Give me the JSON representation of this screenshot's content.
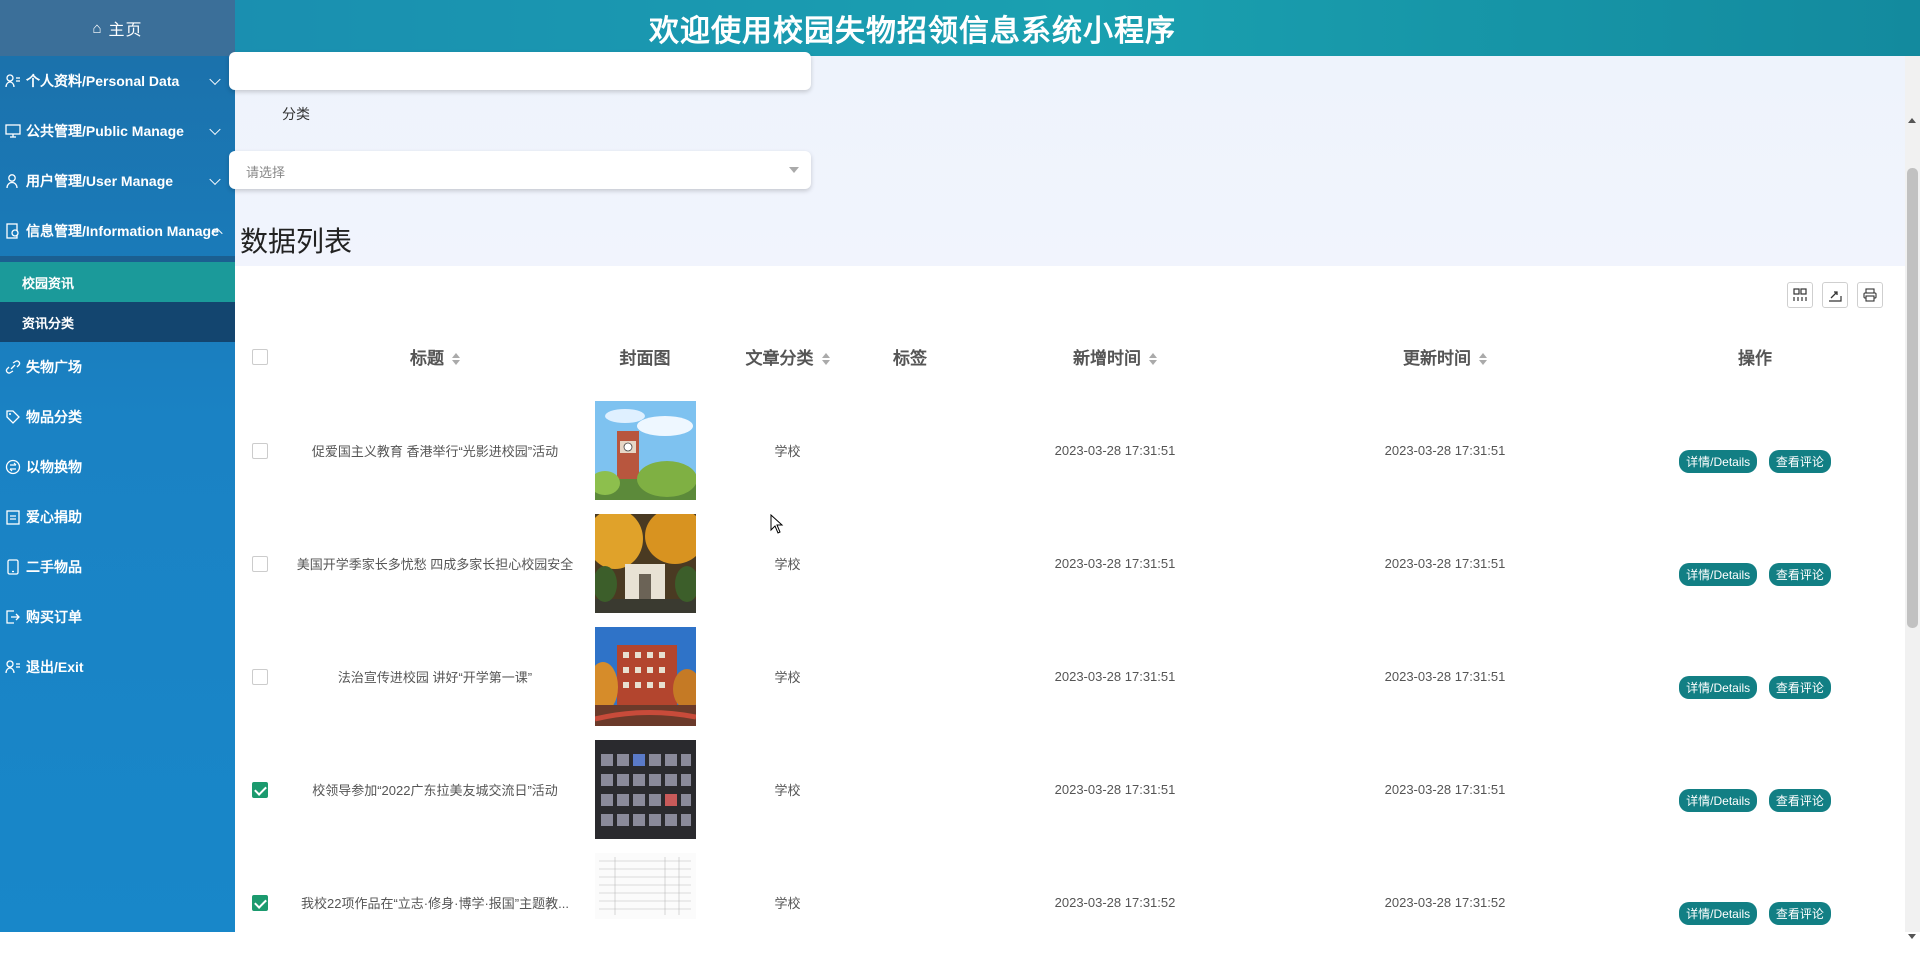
{
  "sidebar": {
    "home_label": "主页",
    "menu": [
      {
        "label": "个人资料/Personal Data"
      },
      {
        "label": "公共管理/Public Manage"
      },
      {
        "label": "用户管理/User Manage"
      },
      {
        "label": "信息管理/Information Manage"
      }
    ],
    "submenu": [
      {
        "label": "校园资讯"
      },
      {
        "label": "资讯分类"
      }
    ],
    "menu2": [
      {
        "label": "失物广场"
      },
      {
        "label": "物品分类"
      },
      {
        "label": "以物换物"
      },
      {
        "label": "爱心捐助"
      },
      {
        "label": "二手物品"
      },
      {
        "label": "购买订单"
      },
      {
        "label": "退出/Exit"
      }
    ]
  },
  "header": {
    "title": "欢迎使用校园失物招领信息系统小程序"
  },
  "filter": {
    "category_label": "分类",
    "category_placeholder": "请选择"
  },
  "list_title": "数据列表",
  "table": {
    "columns": [
      "标题",
      "封面图",
      "文章分类",
      "标签",
      "新增时间",
      "更新时间",
      "操作"
    ],
    "rows": [
      {
        "title": "促爱国主义教育 香港举行“光影进校园”活动",
        "category": "学校",
        "tag": "",
        "created": "2023-03-28 17:31:51",
        "updated": "2023-03-28 17:31:51",
        "checked": false
      },
      {
        "title": "美国开学季家长多忧愁 四成多家长担心校园安全",
        "category": "学校",
        "tag": "",
        "created": "2023-03-28 17:31:51",
        "updated": "2023-03-28 17:31:51",
        "checked": false
      },
      {
        "title": "法治宣传进校园 讲好“开学第一课”",
        "category": "学校",
        "tag": "",
        "created": "2023-03-28 17:31:51",
        "updated": "2023-03-28 17:31:51",
        "checked": false
      },
      {
        "title": "校领导参加“2022广东拉美友城交流日”活动",
        "category": "学校",
        "tag": "",
        "created": "2023-03-28 17:31:51",
        "updated": "2023-03-28 17:31:51",
        "checked": true
      },
      {
        "title": "我校22项作品在“立志·修身·博学·报国”主题教...",
        "category": "学校",
        "tag": "",
        "created": "2023-03-28 17:31:52",
        "updated": "2023-03-28 17:31:52",
        "checked": true
      }
    ],
    "details_label": "详情/Details",
    "comments_label": "查看评论"
  },
  "colors": {
    "header": "#1aa0b0",
    "sidebar": "#1a82c4",
    "active_sub": "#1b9a9a",
    "op_button": "#127f84"
  }
}
